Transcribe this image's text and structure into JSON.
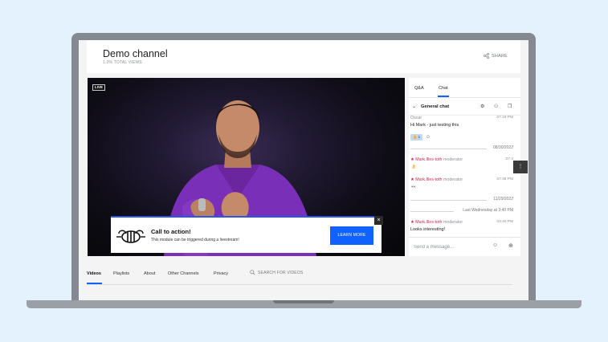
{
  "header": {
    "channel_title": "Demo channel",
    "views": "1.0% TOTAL VIEWS",
    "share_label": "SHARE"
  },
  "video": {
    "live_label": "LIVE",
    "cta": {
      "title": "Call to action!",
      "description": "This module can be triggered during a livestream!",
      "button_label": "LEARN MORE",
      "close_label": "×"
    }
  },
  "chat": {
    "tabs": [
      {
        "label": "Q&A"
      },
      {
        "label": "Chat"
      }
    ],
    "room": {
      "name": "General chat"
    },
    "messages": [
      {
        "author": "Oscar",
        "time": "07:19 PM",
        "text": "Hi Mark - just testing this",
        "reaction": "👍 1"
      },
      {
        "date_separator": "08/30/2022"
      },
      {
        "author": "Mark.Illes-toth",
        "role": "moderator",
        "time": "07:4",
        "text": "👌"
      },
      {
        "author": "Mark.Illes-toth",
        "role": "moderator",
        "time": "07:48 PM",
        "text": "👀"
      },
      {
        "date_separator": "11/29/2022"
      },
      {
        "date_separator": "Last Wednesday at 3:40 PM"
      },
      {
        "author": "Mark.Illes-toth",
        "role": "moderator",
        "time": "03:40 PM",
        "text": "Looks interesting!"
      }
    ],
    "input_placeholder": "Send a message..."
  },
  "nav": {
    "tabs": [
      {
        "label": "Videos"
      },
      {
        "label": "Playlists"
      },
      {
        "label": "About"
      },
      {
        "label": "Other Channels"
      },
      {
        "label": "Privacy"
      }
    ],
    "search_placeholder": "SEARCH FOR VIDEOS"
  },
  "colors": {
    "accent": "#0f62fe",
    "moderator": "#c8294d",
    "background": "#e3f2fc"
  },
  "icons": [
    "share-icon",
    "settings-icon",
    "people-icon",
    "popout-icon",
    "emoji-icon",
    "send-icon",
    "search-icon",
    "chevron-down-icon",
    "close-icon",
    "more-vertical-icon",
    "bee-logo"
  ]
}
